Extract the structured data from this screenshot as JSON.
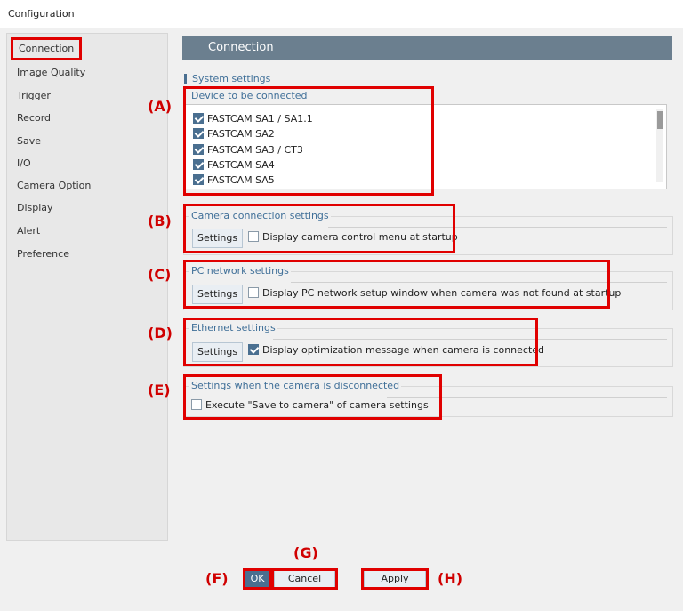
{
  "window": {
    "title": "Configuration"
  },
  "sidebar": {
    "items": [
      {
        "label": "Connection",
        "active": true
      },
      {
        "label": "Image Quality"
      },
      {
        "label": "Trigger"
      },
      {
        "label": "Record"
      },
      {
        "label": "Save"
      },
      {
        "label": "I/O"
      },
      {
        "label": "Camera Option"
      },
      {
        "label": "Display"
      },
      {
        "label": "Alert"
      },
      {
        "label": "Preference"
      }
    ]
  },
  "main": {
    "section_title": "Connection",
    "system_settings_label": "System settings",
    "device_group": {
      "title": "Device to be connected",
      "devices": [
        {
          "label": "FASTCAM SA1 / SA1.1",
          "checked": true
        },
        {
          "label": "FASTCAM SA2",
          "checked": true
        },
        {
          "label": "FASTCAM SA3 / CT3",
          "checked": true
        },
        {
          "label": "FASTCAM SA4",
          "checked": true
        },
        {
          "label": "FASTCAM SA5",
          "checked": true
        }
      ]
    },
    "camera_connection": {
      "title": "Camera connection settings",
      "button": "Settings",
      "option": "Display camera control menu at startup",
      "checked": false
    },
    "pc_network": {
      "title": "PC network settings",
      "button": "Settings",
      "option": "Display PC network setup window when camera was not found at startup",
      "checked": false
    },
    "ethernet": {
      "title": "Ethernet settings",
      "button": "Settings",
      "option": "Display optimization message when camera is connected",
      "checked": true
    },
    "disconnect": {
      "title": "Settings when the camera is disconnected",
      "option": "Execute \"Save to camera\" of camera settings",
      "checked": false
    }
  },
  "footer": {
    "ok": "OK",
    "cancel": "Cancel",
    "apply": "Apply"
  },
  "annotations": {
    "A": "(A)",
    "B": "(B)",
    "C": "(C)",
    "D": "(D)",
    "E": "(E)",
    "F": "(F)",
    "G": "(G)",
    "H": "(H)"
  },
  "colors": {
    "highlight": "#e00000",
    "header_bg": "#6b7f8f",
    "accent": "#4a6f90"
  }
}
